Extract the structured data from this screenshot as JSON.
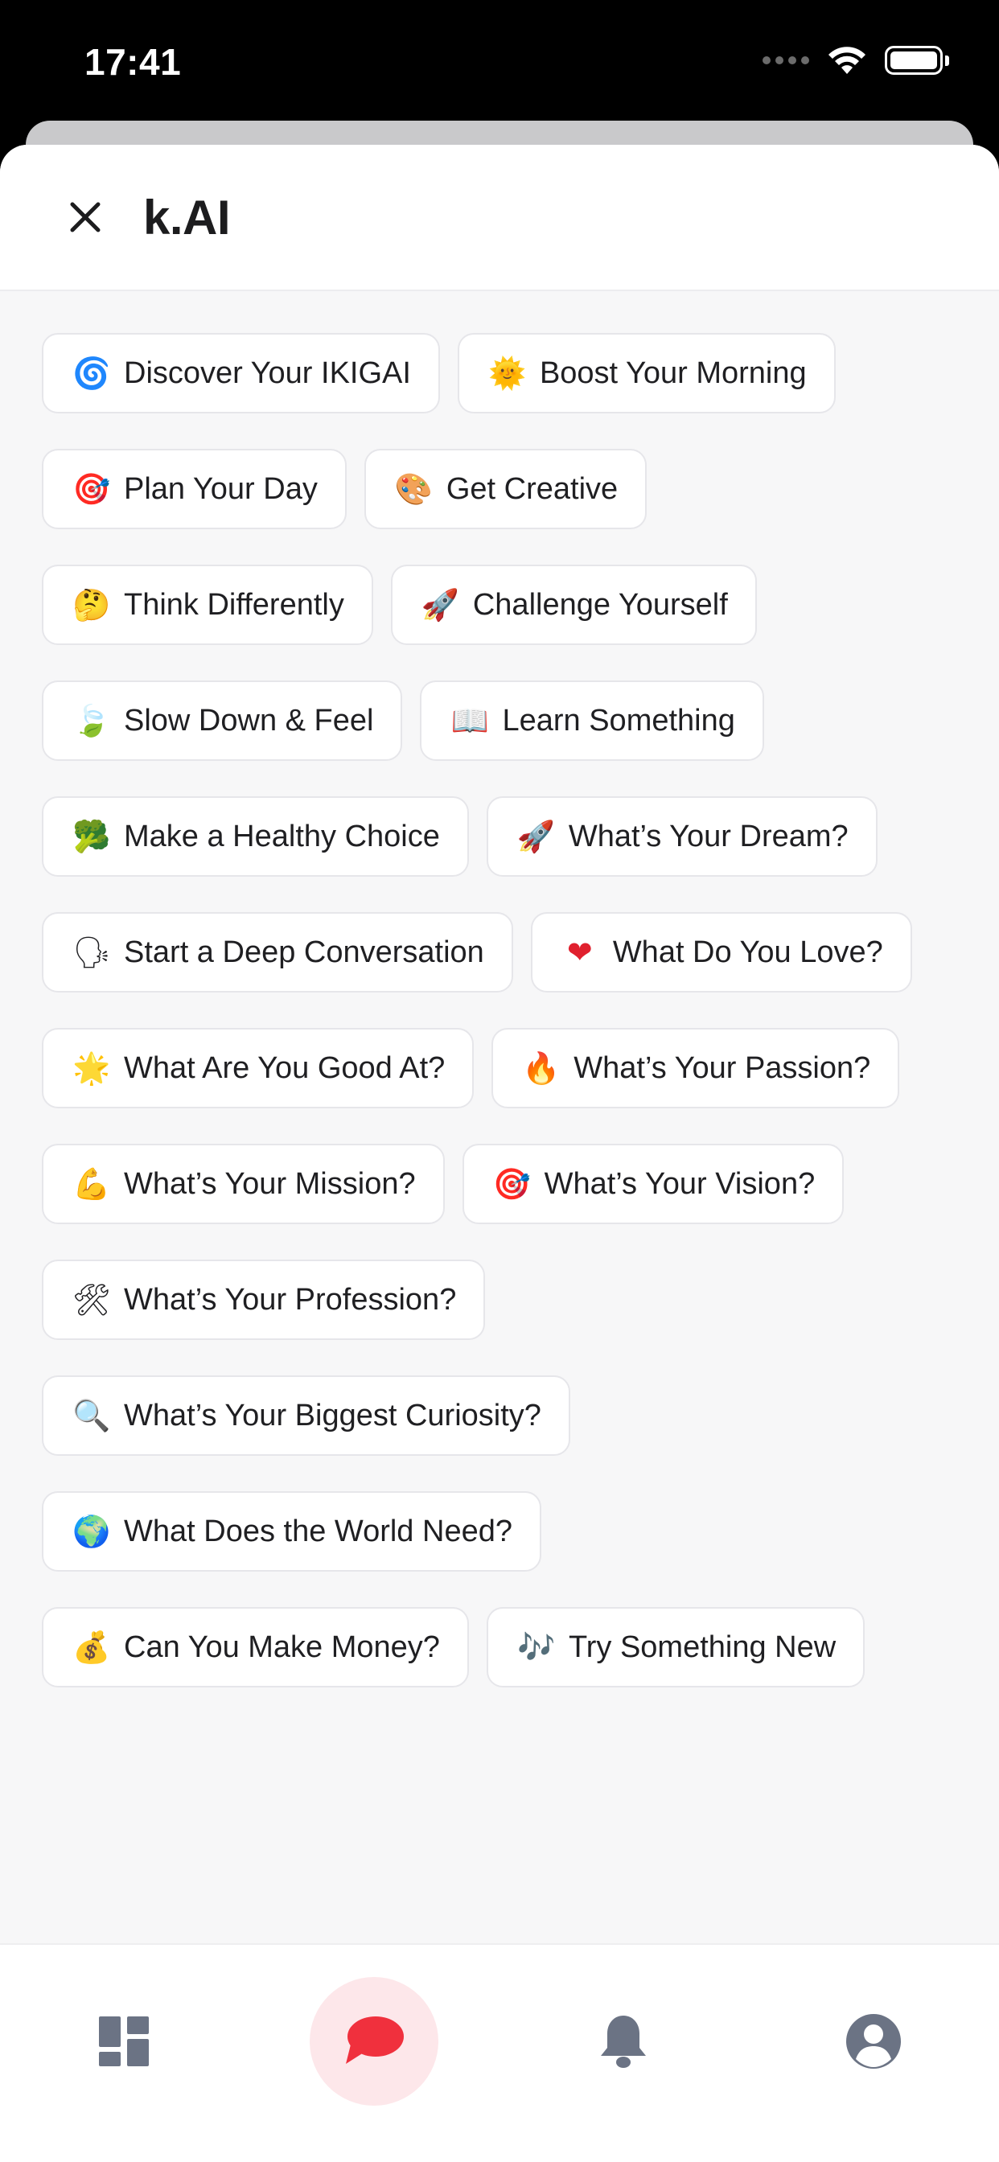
{
  "status_bar": {
    "time": "17:41"
  },
  "sheet": {
    "title": "k.AI"
  },
  "prompts": [
    {
      "emoji": "🌀",
      "label": "Discover Your IKIGAI"
    },
    {
      "emoji": "🌞",
      "label": "Boost Your Morning"
    },
    {
      "emoji": "🎯",
      "label": "Plan Your Day"
    },
    {
      "emoji": "🎨",
      "label": "Get Creative"
    },
    {
      "emoji": "🤔",
      "label": "Think Differently"
    },
    {
      "emoji": "🚀",
      "label": "Challenge Yourself"
    },
    {
      "emoji": "🍃",
      "label": "Slow Down & Feel"
    },
    {
      "emoji": "📖",
      "label": "Learn Something"
    },
    {
      "emoji": "🥦",
      "label": "Make a Healthy Choice"
    },
    {
      "emoji": "🚀",
      "label": "What’s Your Dream?"
    },
    {
      "emoji": "🗣",
      "label": "Start a Deep Conversation"
    },
    {
      "emoji": "❤",
      "label": "What Do You Love?"
    },
    {
      "emoji": "🌟",
      "label": "What Are You Good At?"
    },
    {
      "emoji": "🔥",
      "label": "What’s Your Passion?"
    },
    {
      "emoji": "💪",
      "label": "What’s Your Mission?"
    },
    {
      "emoji": "🎯",
      "label": "What’s Your Vision?"
    },
    {
      "emoji": "🛠",
      "label": "What’s Your Profession?"
    },
    {
      "emoji": "🔍",
      "label": "What’s Your Biggest Curiosity?"
    },
    {
      "emoji": "🌍",
      "label": "What Does the World Need?"
    },
    {
      "emoji": "💰",
      "label": "Can You Make Money?"
    },
    {
      "emoji": "🎶",
      "label": "Try Something New"
    }
  ],
  "bottom_nav": {
    "items": [
      {
        "icon": "dashboard-icon",
        "active": false
      },
      {
        "icon": "chat-bubble-icon",
        "active": true
      },
      {
        "icon": "bell-icon",
        "active": false
      },
      {
        "icon": "user-circle-icon",
        "active": false
      }
    ],
    "active_color": "#f0303d",
    "inactive_color": "#6b7384"
  }
}
